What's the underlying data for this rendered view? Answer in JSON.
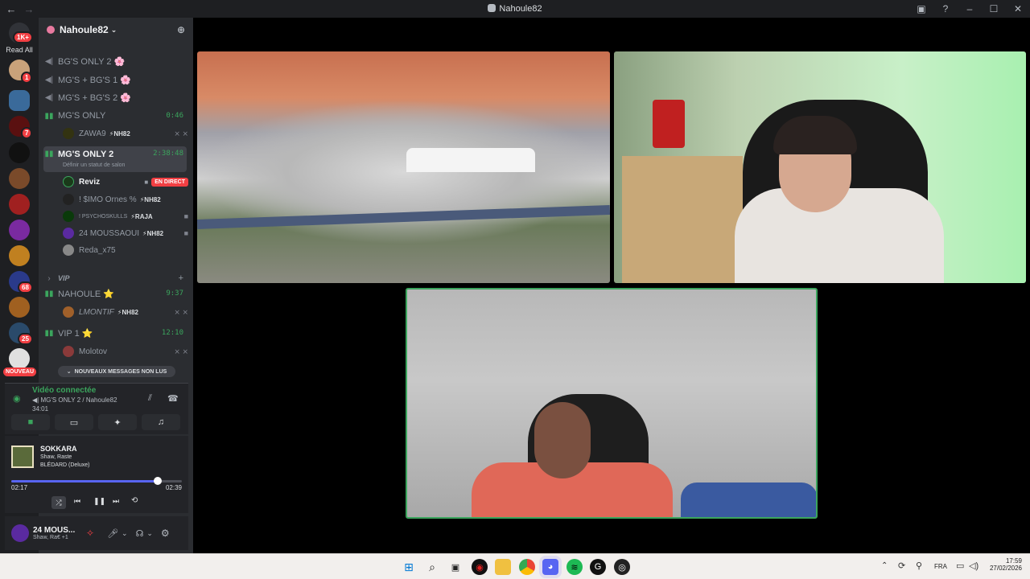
{
  "window": {
    "title": "Nahoule82"
  },
  "guilds": {
    "read_all": "Read All",
    "top_badge": "1K+",
    "badges": [
      "1",
      "7",
      "68",
      "25"
    ],
    "new_label": "NOUVEAU"
  },
  "server": {
    "name": "Nahoule82",
    "channels": [
      {
        "label": "BG'S ONLY 2 🌸"
      },
      {
        "label": "MG'S + BG'S 1 🌸"
      },
      {
        "label": "MG'S + BG'S 2 🌸"
      },
      {
        "label": "MG'S ONLY",
        "duration": "0:46"
      },
      {
        "label": "MG'S ONLY 2",
        "duration": "2:38:48",
        "status": "Définir un statut de salon"
      },
      {
        "label": "NAHOULE ⭐",
        "duration": "9:37"
      },
      {
        "label": "VIP 1 ⭐",
        "duration": "12:10"
      }
    ],
    "category": "VIP",
    "users": {
      "zawa": {
        "name": "ZAWA9",
        "tag": "⚡NH82"
      },
      "reviz": {
        "name": "Reviz",
        "live": "EN DIRECT"
      },
      "simo": {
        "name": "! $IMO Ornes %",
        "tag": "⚡NH82"
      },
      "psycho": {
        "name": "! PSYCHOSKULLS",
        "tag": "⚡RAJA"
      },
      "moussaoui": {
        "name": "24 MOUSSAOUI",
        "tag": "⚡NH82"
      },
      "reda": {
        "name": "Reda_x75"
      },
      "lmontif": {
        "name": "LMONTIF",
        "tag": "⚡NH82"
      },
      "molotov": {
        "name": "Molotov"
      }
    }
  },
  "new_messages": "NOUVEAUX MESSAGES NON LUS",
  "voice": {
    "status": "Vidéo connectée",
    "channel": "MG'S ONLY 2 / Nahoule82",
    "time": "34:01"
  },
  "music": {
    "title": "SOKKARA",
    "artists": "Shaw, Raste",
    "album": "BLÉDARD (Deluxe)",
    "elapsed": "02:17",
    "total": "02:39",
    "progress": 0.86
  },
  "user_panel": {
    "name": "24 MOUS...",
    "activity": "Shaw, Ra€ +1"
  },
  "taskbar": {
    "lang": "FRA",
    "time": "17:59",
    "date": "27/02/2026"
  },
  "colors": {
    "accent_green": "#3ba55d",
    "live_red": "#f23f43",
    "brand": "#5865f2"
  }
}
